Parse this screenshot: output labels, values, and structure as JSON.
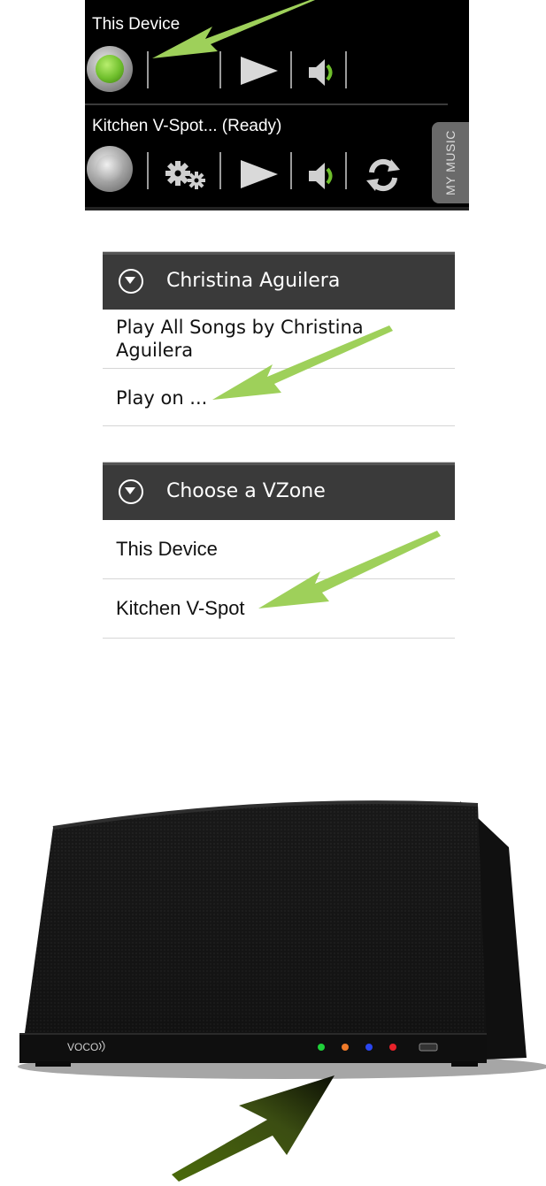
{
  "player_panel": {
    "devices": [
      {
        "name": "This Device",
        "state": "active"
      },
      {
        "name": "Kitchen V-Spot... (Ready)",
        "state": "idle"
      }
    ],
    "side_tab_label": "MY MUSIC"
  },
  "artist_menu": {
    "title": "Christina Aguilera",
    "items": [
      {
        "label": "Play All Songs by Christina Aguilera"
      },
      {
        "label": "Play on ..."
      }
    ]
  },
  "vzone_menu": {
    "title": "Choose a VZone",
    "items": [
      {
        "label": "This Device"
      },
      {
        "label": "Kitchen V-Spot"
      }
    ]
  },
  "speaker": {
    "brand": "VOCO",
    "led_colors": [
      "#1fd13a",
      "#f07b2a",
      "#2a46f0",
      "#e8222a"
    ]
  },
  "colors": {
    "arrow": "#9ed05a",
    "active_orb": "#6fbf2c"
  }
}
